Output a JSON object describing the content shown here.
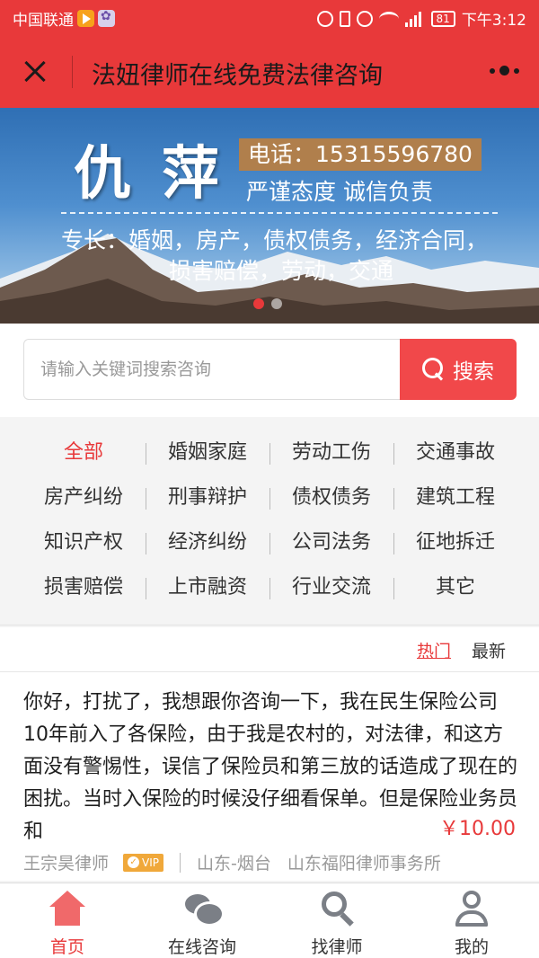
{
  "status_bar": {
    "carrier": "中国联通",
    "battery": "81",
    "time": "下午3:12"
  },
  "header": {
    "title": "法妞律师在线免费法律咨询"
  },
  "banner": {
    "name": "仇萍",
    "phone": "电话：15315596780",
    "motto": "严谨态度 诚信负责",
    "specialty_line1": "专长：婚姻，房产，债权债务，经济合同，",
    "specialty_line2": "损害赔偿，劳动，交通"
  },
  "search": {
    "placeholder": "请输入关键词搜索咨询",
    "button_label": "搜索"
  },
  "categories": [
    "全部",
    "婚姻家庭",
    "劳动工伤",
    "交通事故",
    "房产纠纷",
    "刑事辩护",
    "债权债务",
    "建筑工程",
    "知识产权",
    "经济纠纷",
    "公司法务",
    "征地拆迁",
    "损害赔偿",
    "上市融资",
    "行业交流",
    "其它"
  ],
  "sort": {
    "hot": "热门",
    "latest": "最新"
  },
  "question": {
    "text": "你好，打扰了，我想跟你咨询一下，我在民生保险公司10年前入了各保险，由于我是农村的，对法律，和这方面没有警惕性，误信了保险员和第三放的话造成了现在的困扰。当时入保险的时候没仔细看保单。但是保险业务员和",
    "price": "￥10.00",
    "lawyer": "王宗昊律师",
    "vip": "VIP",
    "location": "山东-烟台",
    "firm": "山东福阳律师事务所"
  },
  "bottom_nav": {
    "home": "首页",
    "consult": "在线咨询",
    "find_lawyer": "找律师",
    "mine": "我的"
  },
  "colors": {
    "brand_red": "#e8393a",
    "search_red": "#f1484a",
    "banner_gold": "#b07f4c"
  }
}
